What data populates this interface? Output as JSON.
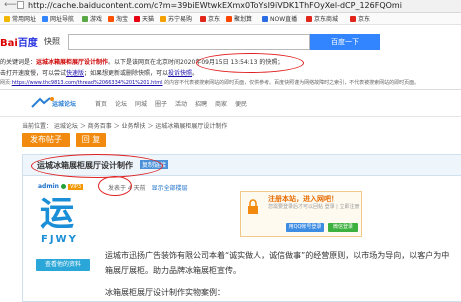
{
  "browser": {
    "url": "http://cache.baiducontent.com/c?m=39biEWtwkEXmx0ToYsI9iVDK1ThFOyXel-dCP_126FQOmi",
    "bookmarks": [
      "常用网址",
      "网址导航",
      "游戏",
      "淘宝",
      "天猫",
      "苏宁易购",
      "京东",
      "聚划算",
      "NOW直播",
      "京东商城",
      "京东"
    ]
  },
  "baidu": {
    "logo_a": "Bai",
    "logo_b": "百度",
    "kuaizhao": "快照",
    "search_button": "百度一下"
  },
  "notice": {
    "line1_pre": "的关键词是：",
    "line1_kw": "运城冰箱展柜展厅设计制作",
    "line1_mid": "。以下是该网页在北京时间",
    "line1_time": "2020年09月15日 13:54:13",
    "line1_post": " 的快照；",
    "line2_pre": "击打开速度慢，可以尝试",
    "line2_link1": "快速版",
    "line2_mid": "；如果想更新或删除快照，可以",
    "line2_link2": "投诉快照",
    "line2_end": "。",
    "line3_pre": "网页:",
    "line3_url": "https://www.thc9813.com/thread%2066334%201%201.html",
    "line3_post": " 的内容不代表被搜索网站的即时页面，仅供参考。百度快照谨为网络故障时之索引，不代表被搜索网站的即时页面。"
  },
  "forum": {
    "logo_text": "运城论坛",
    "nav": [
      "首页",
      "论坛",
      "同城",
      "圈子",
      "活动",
      "招聘",
      "商家",
      "便民"
    ],
    "nav_sub": "当前位置：运城论坛 ＞ 商务百事 ＞ 业务帮扶"
  },
  "breadcrumb": "当前位置： 运城论坛 ＞ 商务百事 ＞ 业务帮扶 ＞ 运城冰箱展柜展厅设计制作",
  "actions": {
    "post": "发布帖子",
    "reply": "回 复"
  },
  "thread": {
    "title": "运城冰箱展柜展厅设计制作",
    "badge": "复制链接",
    "author": "admin",
    "vip": "VIP3",
    "meta": "发表于 4 天前",
    "meta2": "显示全部楼层",
    "avatar_char": "运",
    "avatar_sub": "FJWY",
    "view_profile": "查看他的资料",
    "body": [
      "运城市迅扬广告装饰有限公司本着“诚实做人，诚信做事”的经营原则，以市场为导向，以客户为中",
      "箱展厅展柜。助力品牌冰箱展柜宣传。",
      "冰箱展柜展厅设计制作实物案例："
    ]
  },
  "login": {
    "title": "注册本站，进入网吧！",
    "sub": "您需要登录后才可以回帖 登录 | 立即注册",
    "qq": "用QQ帐号登录",
    "wx": "微信登录"
  },
  "colors": {
    "accent_orange": "#f28a0f",
    "baidu_blue": "#3385ff",
    "annotation_red": "#e02020"
  }
}
